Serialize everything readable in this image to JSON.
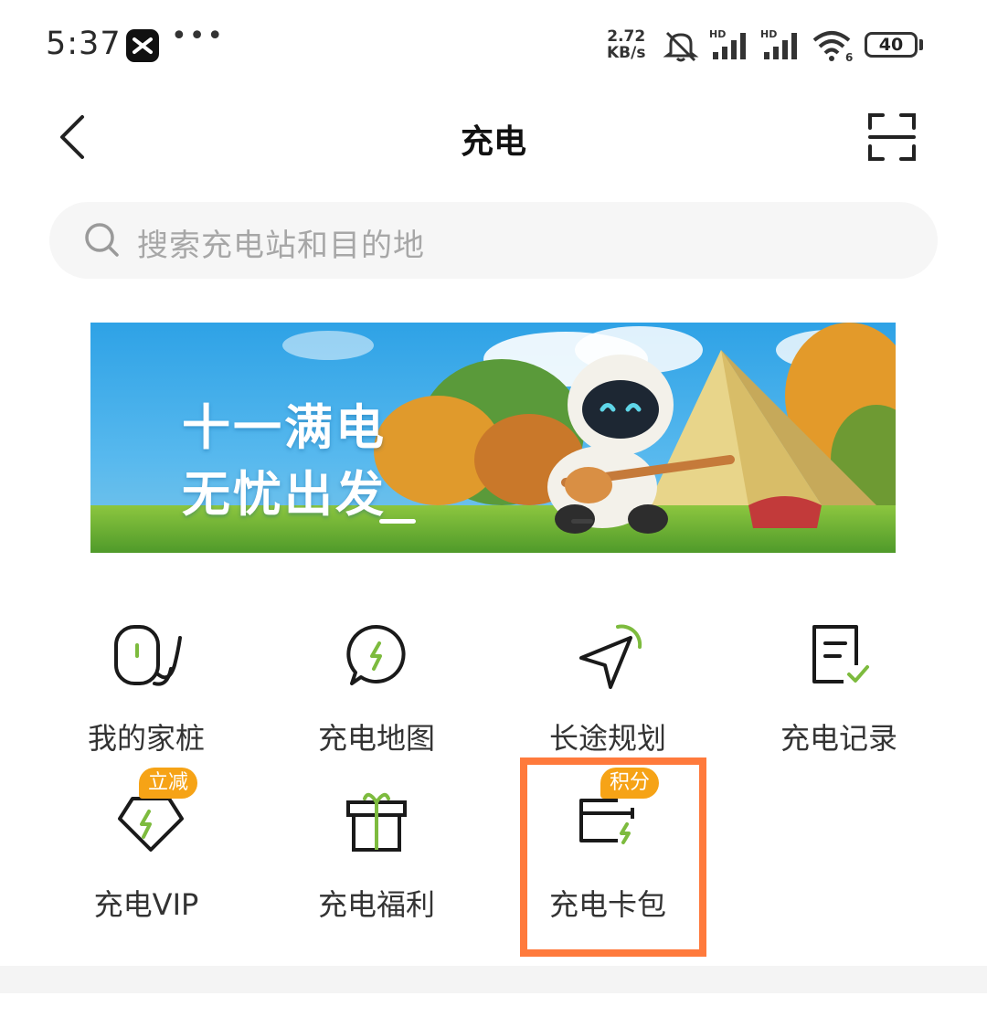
{
  "status_bar": {
    "time": "5:37",
    "net_speed_value": "2.72",
    "net_speed_unit": "KB/s",
    "battery_level": "40",
    "icons": [
      "app-notification-icon",
      "more-dots-icon",
      "mute-icon",
      "signal-hd-icon",
      "signal-hd-icon",
      "wifi-icon",
      "battery-icon"
    ]
  },
  "nav": {
    "title": "充电"
  },
  "search": {
    "placeholder": "搜索充电站和目的地"
  },
  "banner": {
    "line1": "十一满电",
    "line2": "无忧出发"
  },
  "grid": [
    {
      "label": "我的家桩",
      "icon": "home-charger-icon"
    },
    {
      "label": "充电地图",
      "icon": "charging-map-icon"
    },
    {
      "label": "长途规划",
      "icon": "route-planning-icon"
    },
    {
      "label": "充电记录",
      "icon": "charging-record-icon"
    },
    {
      "label": "充电VIP",
      "icon": "vip-diamond-icon",
      "badge": "立减"
    },
    {
      "label": "充电福利",
      "icon": "gift-box-icon"
    },
    {
      "label": "充电卡包",
      "icon": "card-wallet-icon",
      "badge": "积分"
    }
  ],
  "colors": {
    "accent_green": "#7dbb3e",
    "badge_orange": "#f6a316",
    "highlight_border": "#ff7a3c"
  }
}
